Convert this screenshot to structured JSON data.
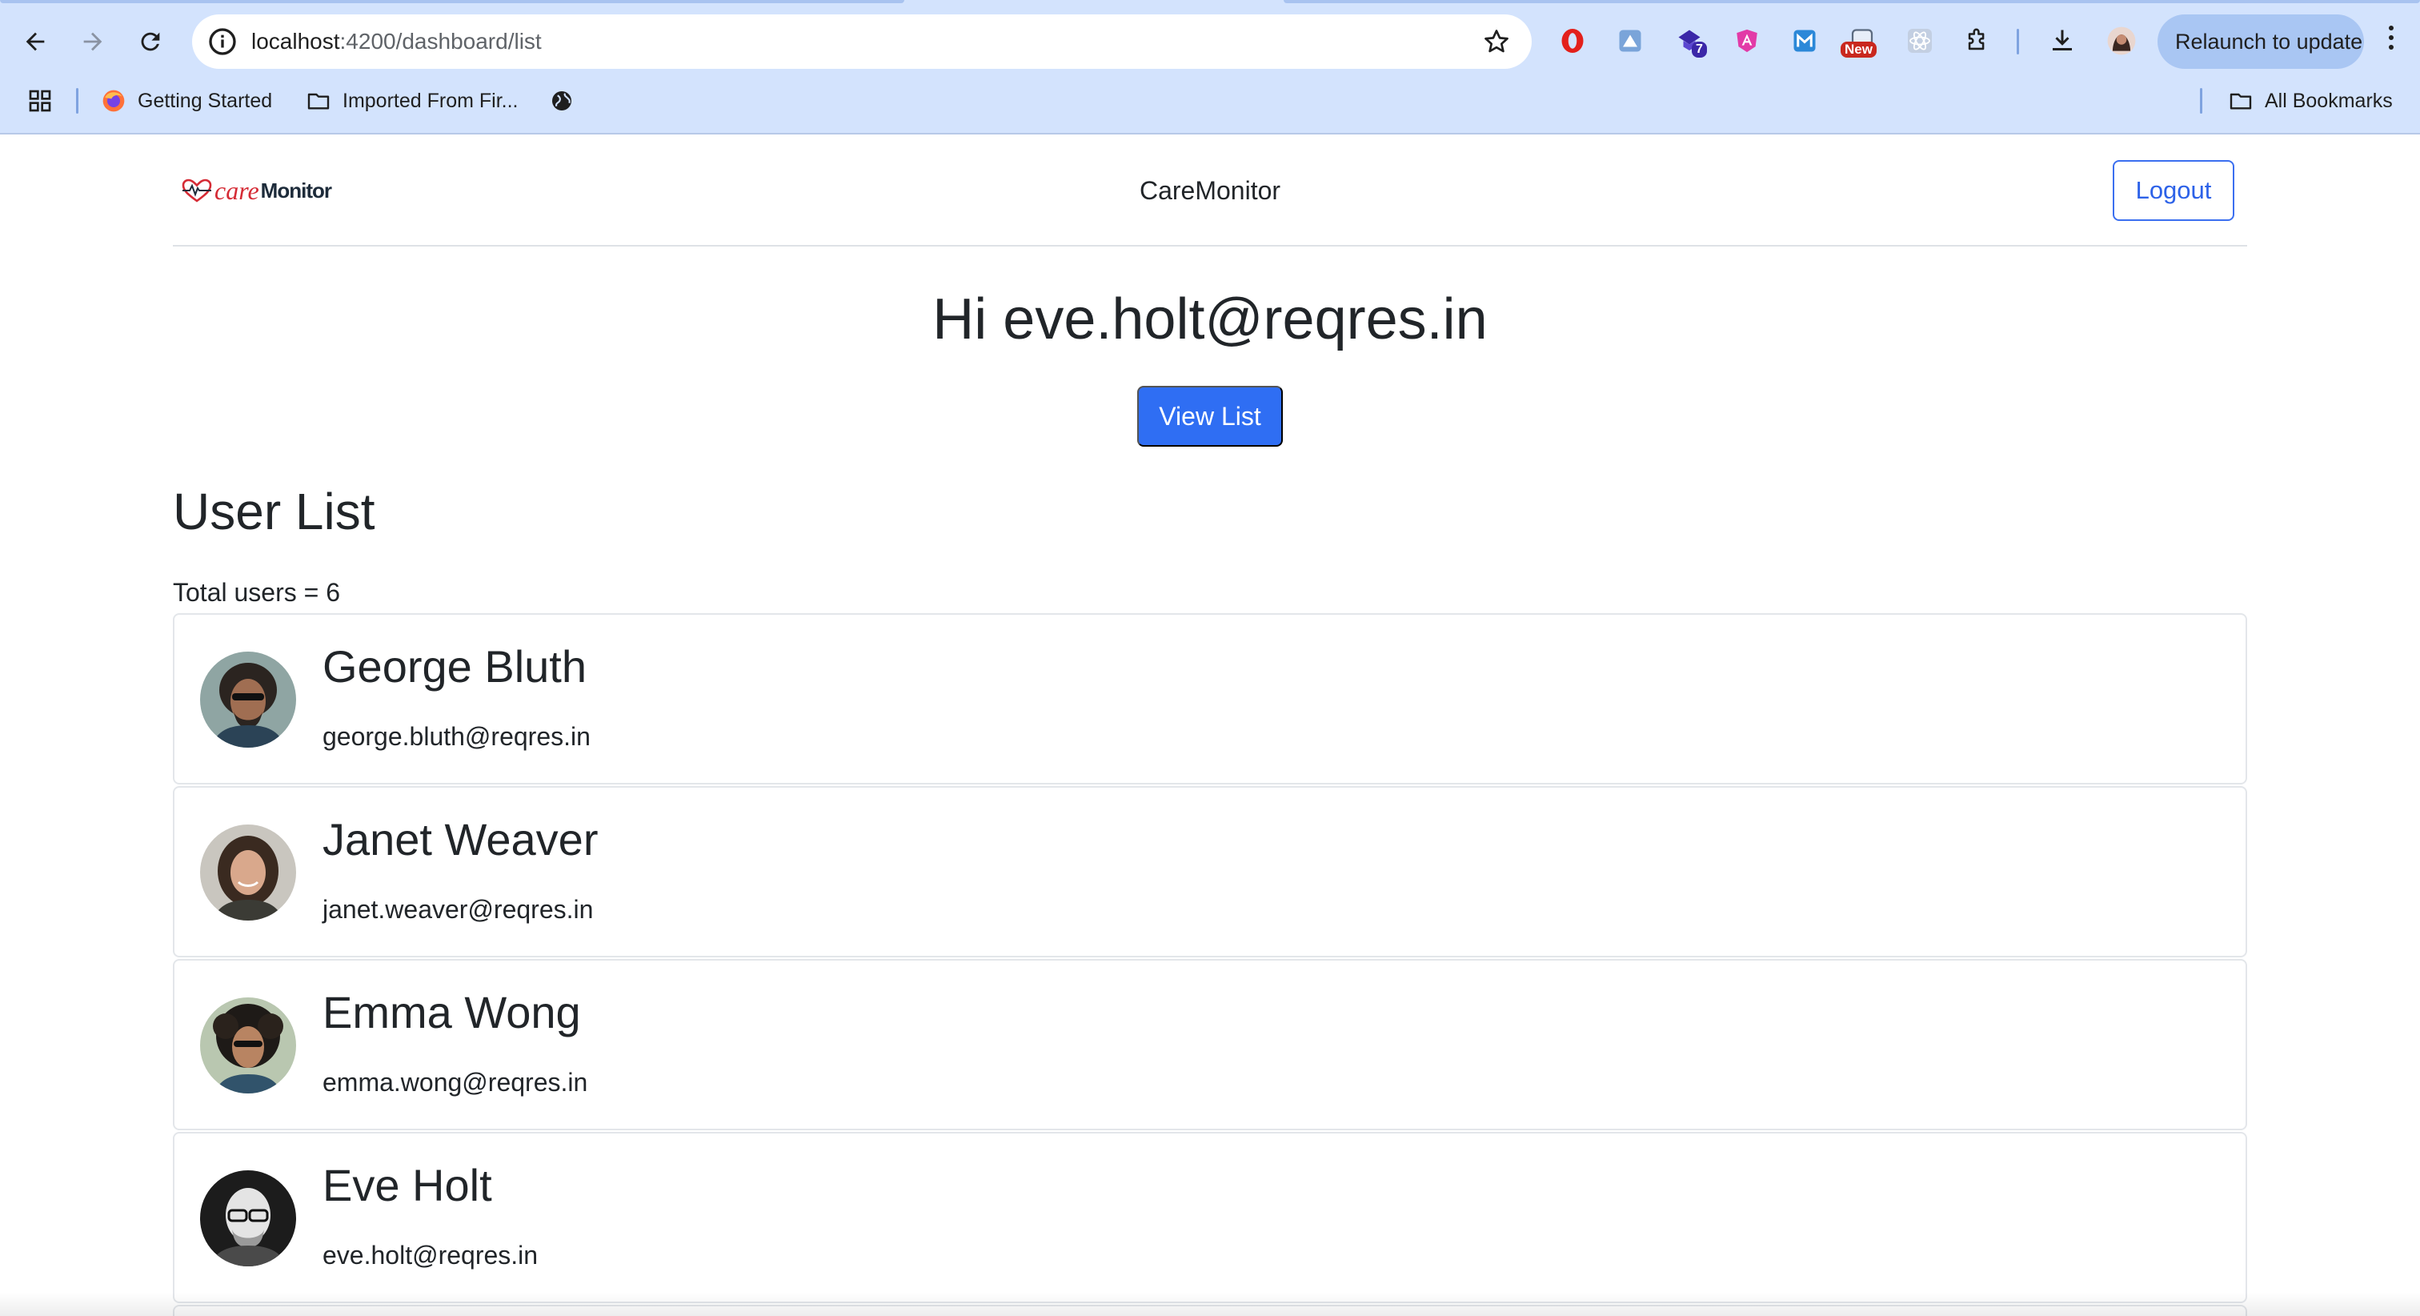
{
  "browser": {
    "url_host": "localhost",
    "url_path": ":4200/dashboard/list",
    "relaunch_label": "Relaunch to update",
    "extension_badges": {
      "tasks": "7",
      "news": "New"
    },
    "bookmarks": [
      {
        "label": "Getting Started",
        "icon": "firefox-icon"
      },
      {
        "label": "Imported From Fir...",
        "icon": "folder-icon"
      },
      {
        "label": "",
        "icon": "globe-icon"
      }
    ],
    "all_bookmarks_label": "All Bookmarks"
  },
  "navbar": {
    "logo_care": "care",
    "logo_monitor": "Monitor",
    "brand_title": "CareMonitor",
    "logout_label": "Logout"
  },
  "main": {
    "greeting": "Hi eve.holt@reqres.in",
    "view_list_label": "View List",
    "list_title": "User List",
    "total_users": "Total users = 6"
  },
  "users": [
    {
      "name": "George Bluth",
      "email": "george.bluth@reqres.in",
      "avatar": "george-avatar"
    },
    {
      "name": "Janet Weaver",
      "email": "janet.weaver@reqres.in",
      "avatar": "janet-avatar"
    },
    {
      "name": "Emma Wong",
      "email": "emma.wong@reqres.in",
      "avatar": "emma-avatar"
    },
    {
      "name": "Eve Holt",
      "email": "eve.holt@reqres.in",
      "avatar": "eve-avatar"
    }
  ],
  "colors": {
    "primary": "#2f6ef3",
    "chrome_bg": "#d3e3fd",
    "logo_red": "#d52b35"
  }
}
